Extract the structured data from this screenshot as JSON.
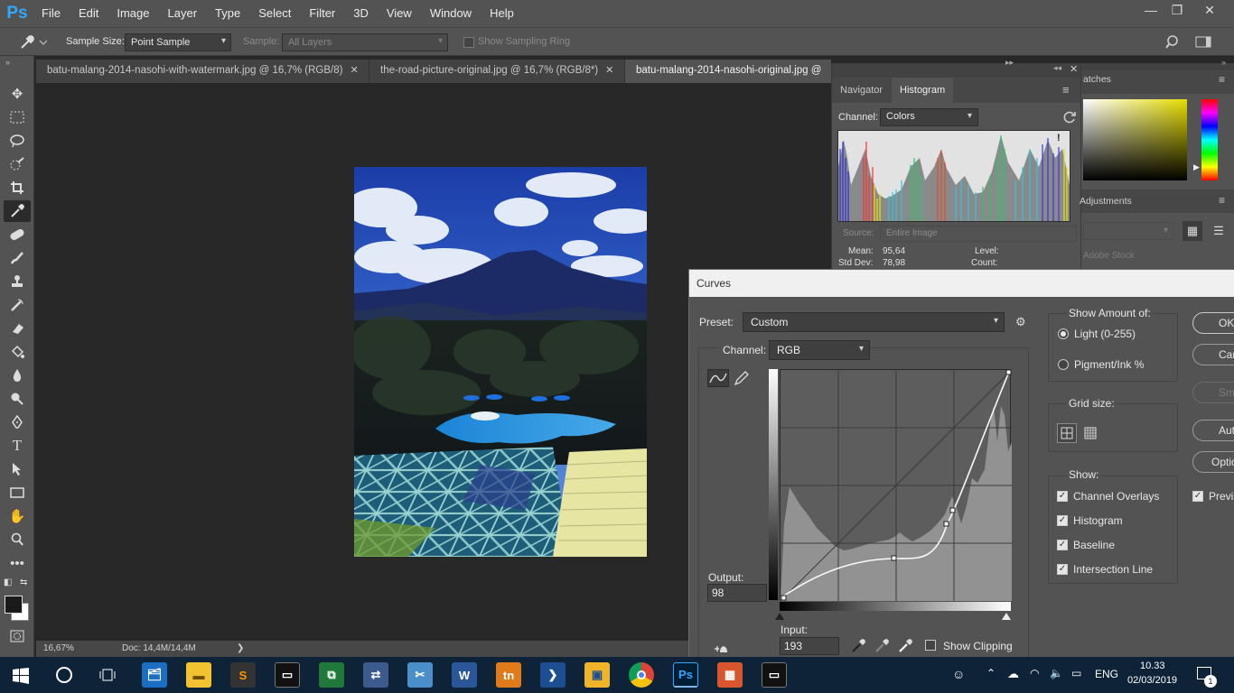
{
  "app": {
    "logo": "Ps",
    "name": "Adobe Photoshop"
  },
  "menu": [
    "File",
    "Edit",
    "Image",
    "Layer",
    "Type",
    "Select",
    "Filter",
    "3D",
    "View",
    "Window",
    "Help"
  ],
  "window_controls": {
    "minimize": "—",
    "restore": "❐",
    "close": "✕"
  },
  "options_bar": {
    "sample_size_label": "Sample Size:",
    "sample_size_value": "Point Sample",
    "sample_label": "Sample:",
    "sample_value": "All Layers",
    "show_ring_label": "Show Sampling Ring"
  },
  "tools": [
    "move-icon",
    "marquee-icon",
    "lasso-icon",
    "quick-selection-icon",
    "crop-icon",
    "eyedropper-icon",
    "healing-icon",
    "brush-icon",
    "stamp-icon",
    "history-brush-icon",
    "eraser-icon",
    "bucket-icon",
    "blur-icon",
    "dodge-icon",
    "pen-icon",
    "type-icon",
    "path-select-icon",
    "rectangle-icon",
    "hand-icon",
    "zoom-icon",
    "more-icon"
  ],
  "doc_tabs": [
    {
      "label": "batu-malang-2014-nasohi-with-watermark.jpg @ 16,7% (RGB/8)",
      "close": "✕",
      "active": false
    },
    {
      "label": "the-road-picture-original.jpg @ 16,7% (RGB/8*)",
      "close": "✕",
      "active": false
    },
    {
      "label": "batu-malang-2014-nasohi-original.jpg @",
      "close": "",
      "active": true
    }
  ],
  "status": {
    "zoom": "16,67%",
    "doc": "Doc: 14,4M/14,4M",
    "arrow": "❯"
  },
  "histogram_panel": {
    "tabs": [
      "Navigator",
      "Histogram"
    ],
    "active_tab": "Histogram",
    "channel_label": "Channel:",
    "channel_value": "Colors",
    "source_label": "Source:",
    "source_value": "Entire Image",
    "mean_label": "Mean:",
    "mean_value": "95,64",
    "std_label": "Std Dev:",
    "std_value": "78,98",
    "level_label": "Level:",
    "count_label": "Count:",
    "warning": "!"
  },
  "right_panels": {
    "swatches_tab": "atches",
    "adjustments_tab": "Adjustments",
    "stock_label": "Adobe Stock"
  },
  "curves": {
    "title": "Curves",
    "preset_label": "Preset:",
    "preset_value": "Custom",
    "channel_label": "Channel:",
    "channel_value": "RGB",
    "output_label": "Output:",
    "output_value": "98",
    "input_label": "Input:",
    "input_value": "193",
    "show_clipping_label": "Show Clipping",
    "show_amount_title": "Show Amount of:",
    "light_label": "Light  (0-255)",
    "pigment_label": "Pigment/Ink %",
    "grid_size_title": "Grid size:",
    "show_title": "Show:",
    "show_options": [
      "Channel Overlays",
      "Histogram",
      "Baseline",
      "Intersection Line"
    ],
    "buttons": [
      "OK",
      "Cancel",
      "Smooth",
      "Auto",
      "Options..."
    ],
    "preview_label": "Preview"
  },
  "taskbar": {
    "apps": [
      "Search",
      "Task View",
      "File Explorer",
      "Files",
      "Sublime Text",
      "Terminal",
      "Network",
      "Remote",
      "Snipping",
      "Word",
      "Tn",
      "PowerShell",
      "Notes",
      "Chrome",
      "Photoshop",
      "Gallery",
      "Console"
    ],
    "lang": "ENG",
    "time": "10.33",
    "date": "02/03/2019",
    "notif": "1"
  },
  "colors": {
    "accent": "#31a8ff",
    "panel": "#535353",
    "canvas": "#282828",
    "taskbar": "#0f2338"
  }
}
